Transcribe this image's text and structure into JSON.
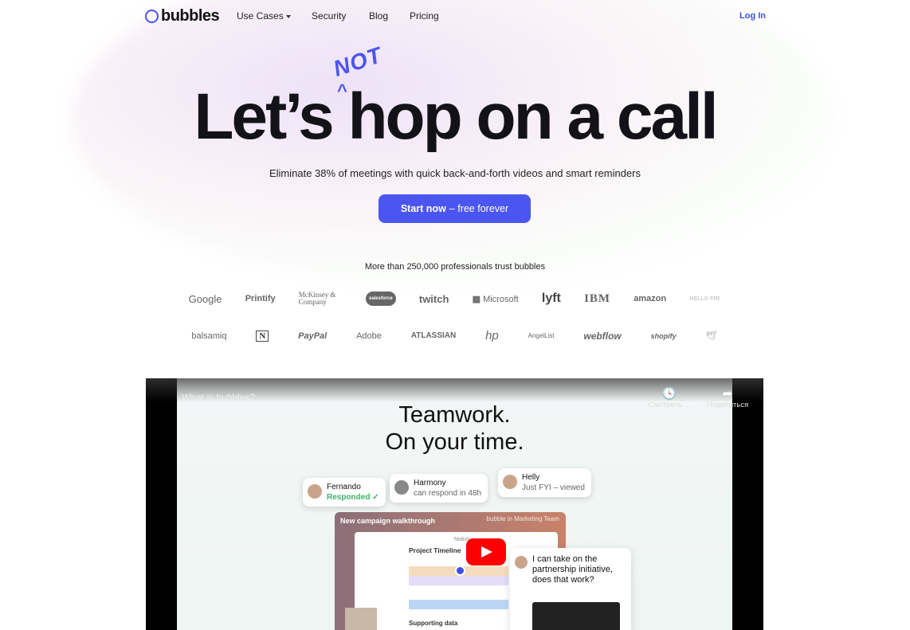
{
  "nav": {
    "brand": "bubbles",
    "items": [
      "Use Cases",
      "Security",
      "Blog",
      "Pricing"
    ],
    "login": "Log In"
  },
  "hero": {
    "title": "Let’s hop on a call",
    "insert": "NOT",
    "subtitle": "Eliminate 38% of meetings with quick back-and-forth videos and smart reminders",
    "cta_bold": "Start now",
    "cta_rest": "– free forever"
  },
  "trust": {
    "text": "More than 250,000 professionals trust bubbles",
    "row1": [
      "Google",
      "Printify",
      "McKinsey & Company",
      "salesforce",
      "twitch",
      "Microsoft",
      "lyft",
      "IBM",
      "amazon",
      "HELLO FRESH"
    ],
    "row2": [
      "balsamiq",
      "N",
      "PayPal",
      "Adobe",
      "ATLASSIAN",
      "hp",
      "AngelList",
      "webflow",
      "shopify"
    ]
  },
  "video": {
    "title": "What is bubbles?",
    "watch_later": "Смотреть ...",
    "share": "Поделиться",
    "headline1": "Teamwork.",
    "headline2": "On your time.",
    "chips": [
      {
        "name": "Fernando",
        "status": "Responded ✓"
      },
      {
        "name": "Harmony",
        "status": "can respond in 48h"
      },
      {
        "name": "Helly",
        "status": "Just FYI – viewed"
      }
    ],
    "card_title": "New campaign walkthrough",
    "card_meta": "bubble in Marketing Team",
    "doc_source": "Notion",
    "doc_title": "Project Timeline",
    "doc_section": "Supporting data",
    "message": "I can take on the partnership initiative, does that work?"
  },
  "colors": {
    "accent": "#4b56f2",
    "youtube": "#ff0000"
  }
}
